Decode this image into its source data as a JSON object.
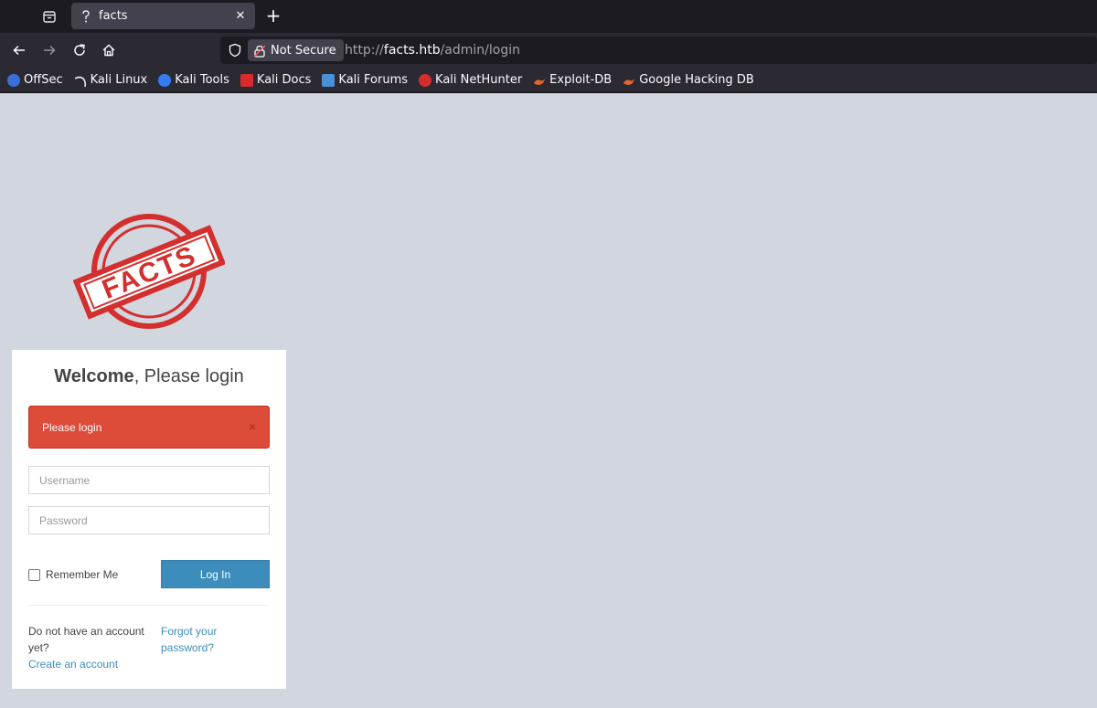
{
  "browser": {
    "tab": {
      "title": "facts"
    },
    "security": {
      "label": "Not Secure"
    },
    "url": {
      "scheme": "http://",
      "host": "facts.htb",
      "path": "/admin/login"
    },
    "bookmarks": [
      {
        "label": "OffSec",
        "icon": "offsec-icon",
        "color": "#3a6fd8"
      },
      {
        "label": "Kali Linux",
        "icon": "kali-dragon-icon",
        "color": "#e8e8ee"
      },
      {
        "label": "Kali Tools",
        "icon": "kali-tools-icon",
        "color": "#367bf0"
      },
      {
        "label": "Kali Docs",
        "icon": "kali-docs-icon",
        "color": "#d92b2b"
      },
      {
        "label": "Kali Forums",
        "icon": "kali-forums-icon",
        "color": "#4a90d9"
      },
      {
        "label": "Kali NetHunter",
        "icon": "nethunter-icon",
        "color": "#d62c2c"
      },
      {
        "label": "Exploit-DB",
        "icon": "exploit-db-icon",
        "color": "#e5642a"
      },
      {
        "label": "Google Hacking DB",
        "icon": "ghdb-icon",
        "color": "#e5642a"
      }
    ]
  },
  "page": {
    "logo": {
      "text": "FACTS",
      "color": "#d32f2f"
    },
    "login": {
      "title_bold": "Welcome",
      "title_rest": ", Please login",
      "alert": {
        "text": "Please login",
        "close": "×",
        "color": "#dd4b39"
      },
      "username_placeholder": "Username",
      "password_placeholder": "Password",
      "remember_label": "Remember Me",
      "login_button": "Log In",
      "no_account_text": "Do not have an account yet?",
      "create_account_link": "Create an account",
      "forgot_password_link": "Forgot your password?",
      "accent_color": "#3c8dbc"
    }
  }
}
